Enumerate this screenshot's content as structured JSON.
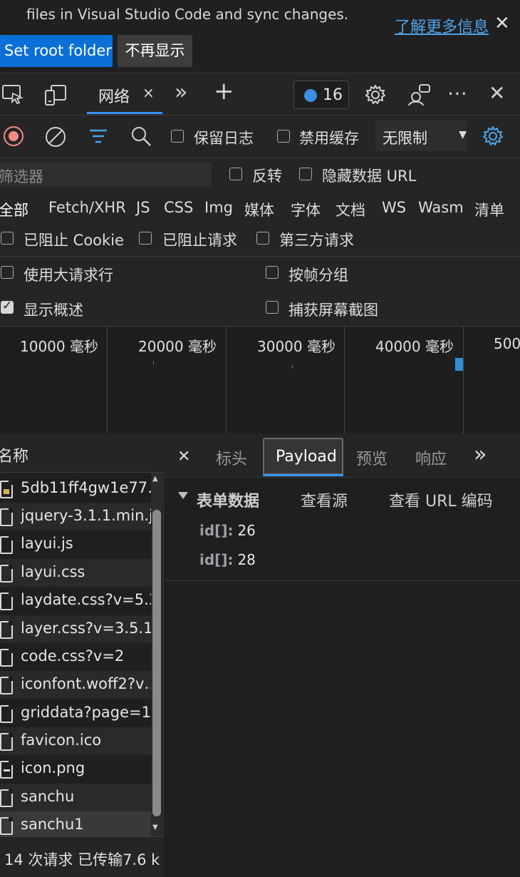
{
  "banner": {
    "message_partial": "… your project's … files in Visual Studio Code and sync changes.",
    "message_line2": "files in Visual Studio Code and sync changes.",
    "learn_more": "了解更多信息",
    "close_glyph": "✕",
    "set_root_label": "Set root folder",
    "dont_show_label": "不再显示"
  },
  "tabs": {
    "network_label": "网络",
    "close_glyph": "×",
    "more_glyph": "»",
    "add_glyph": "+",
    "issues_count": "16",
    "menu_glyph": "⋯",
    "close_devtools_glyph": "✕"
  },
  "toolbar": {
    "preserve_log": "保留日志",
    "disable_cache": "禁用缓存",
    "throttle_value": "无限制"
  },
  "filter": {
    "placeholder": "筛选器",
    "invert": "反转",
    "hide_data_url": "隐藏数据 URL"
  },
  "types": [
    "全部",
    "Fetch/XHR",
    "JS",
    "CSS",
    "Img",
    "媒体",
    "字体",
    "文档",
    "WS",
    "Wasm",
    "清单"
  ],
  "cookie_row": {
    "blocked_cookies": "已阻止 Cookie",
    "blocked_requests": "已阻止请求",
    "third_party": "第三方请求"
  },
  "options": {
    "big_rows": "使用大请求行",
    "group_by_frame": "按帧分组",
    "show_overview": "显示概述",
    "capture_screenshots": "捕获屏幕截图",
    "show_overview_checked": true
  },
  "timeline": {
    "ticks": [
      "10000  毫秒",
      "20000  毫秒",
      "30000  毫秒",
      "40000  毫秒",
      "500"
    ]
  },
  "requests": {
    "header": "名称",
    "files": [
      {
        "name": "5db11ff4gw1e77…",
        "icon": "image-file-icon"
      },
      {
        "name": "jquery-3.1.1.min.js",
        "icon": "file-icon"
      },
      {
        "name": "layui.js",
        "icon": "file-icon"
      },
      {
        "name": "layui.css",
        "icon": "file-icon"
      },
      {
        "name": "laydate.css?v=5.3.",
        "icon": "file-icon"
      },
      {
        "name": "layer.css?v=3.5.1",
        "icon": "file-icon"
      },
      {
        "name": "code.css?v=2",
        "icon": "file-icon"
      },
      {
        "name": "iconfont.woff2?v…",
        "icon": "file-icon"
      },
      {
        "name": "griddata?page=1…",
        "icon": "file-icon"
      },
      {
        "name": "favicon.ico",
        "icon": "file-icon"
      },
      {
        "name": "icon.png",
        "icon": "png-file-icon"
      },
      {
        "name": "sanchu",
        "icon": "file-icon"
      },
      {
        "name": "sanchu1",
        "icon": "file-icon"
      }
    ],
    "status": "14 次请求  已传输7.6 k"
  },
  "detail": {
    "close_glyph": "✕",
    "tabs": [
      "标头",
      "Payload",
      "预览",
      "响应"
    ],
    "more_glyph": "»",
    "section_title": "表单数据",
    "view_source": "查看源",
    "view_url_encoded": "查看 URL 编码",
    "form": [
      {
        "key": "id[]:",
        "value": "26"
      },
      {
        "key": "id[]:",
        "value": "28"
      }
    ]
  }
}
